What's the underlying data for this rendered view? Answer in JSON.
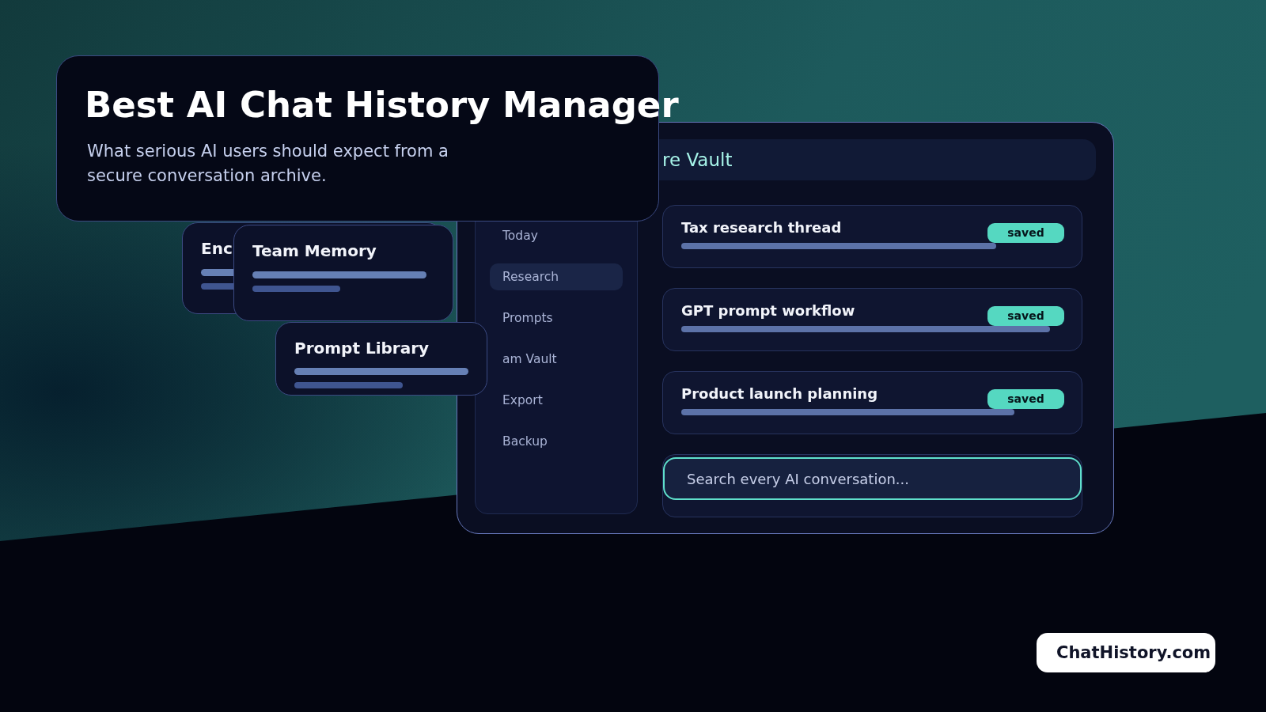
{
  "hero": {
    "title": "Best AI Chat History Manager",
    "subtitle": "What serious AI users should expect from a secure conversation archive."
  },
  "feature_cards": [
    {
      "title": "Enc"
    },
    {
      "title": "Team Memory"
    },
    {
      "title": "Prompt Library"
    }
  ],
  "vault": {
    "title": "re Vault",
    "sidebar": {
      "items": [
        {
          "label": "Today",
          "selected": false
        },
        {
          "label": "Research",
          "selected": true
        },
        {
          "label": "Prompts",
          "selected": false
        },
        {
          "label": "am Vault",
          "selected": false
        },
        {
          "label": "Export",
          "selected": false
        },
        {
          "label": "Backup",
          "selected": false
        }
      ]
    },
    "conversations": [
      {
        "title": "Tax research thread",
        "badge": "saved"
      },
      {
        "title": "GPT prompt workflow",
        "badge": "saved"
      },
      {
        "title": "Product launch planning",
        "badge": "saved"
      }
    ],
    "search": {
      "placeholder": "Search every AI conversation..."
    }
  },
  "brand": "ChatHistory.com"
}
